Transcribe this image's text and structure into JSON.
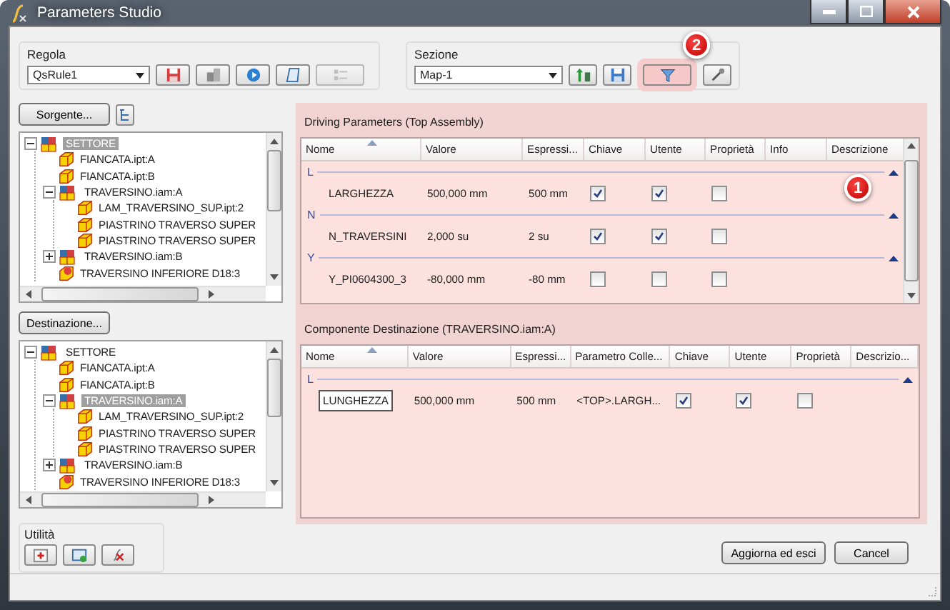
{
  "window": {
    "title": "Parameters Studio"
  },
  "regola": {
    "label": "Regola",
    "value": "QsRule1",
    "buttons": [
      {
        "kind": "save-red",
        "disabled": false
      },
      {
        "kind": "components",
        "disabled": false
      },
      {
        "kind": "run",
        "disabled": false
      },
      {
        "kind": "script",
        "disabled": false
      },
      {
        "kind": "list",
        "disabled": true
      }
    ]
  },
  "sezione": {
    "label": "Sezione",
    "value": "Map-1",
    "callout": "2",
    "buttons": [
      {
        "kind": "sort",
        "highlighted": false
      },
      {
        "kind": "save-blue",
        "highlighted": false
      },
      {
        "kind": "filter",
        "highlighted": true
      },
      {
        "kind": "tools",
        "highlighted": false
      }
    ]
  },
  "source": {
    "button": "Sorgente...",
    "tree": [
      {
        "label": "SETTORE",
        "kind": "assembly",
        "expanded": true,
        "selected": true,
        "children": [
          {
            "label": "FIANCATA.ipt:A",
            "kind": "part",
            "selected": false
          },
          {
            "label": "FIANCATA.ipt:B",
            "kind": "part",
            "selected": false
          },
          {
            "label": "TRAVERSINO.iam:A",
            "kind": "assembly",
            "expanded": true,
            "selected": false,
            "children": [
              {
                "label": "LAM_TRAVERSINO_SUP.ipt:2",
                "kind": "part",
                "selected": false
              },
              {
                "label": "PIASTRINO TRAVERSO SUPER",
                "kind": "part",
                "selected": false
              },
              {
                "label": "PIASTRINO TRAVERSO SUPER",
                "kind": "part",
                "selected": false
              }
            ]
          },
          {
            "label": "TRAVERSINO.iam:B",
            "kind": "assembly",
            "expanded": false,
            "selected": false
          },
          {
            "label": "TRAVERSINO INFERIORE D18:3",
            "kind": "linked",
            "selected": false
          }
        ]
      }
    ]
  },
  "destination": {
    "button": "Destinazione...",
    "tree": [
      {
        "label": "SETTORE",
        "kind": "assembly",
        "expanded": true,
        "selected": false,
        "children": [
          {
            "label": "FIANCATA.ipt:A",
            "kind": "part",
            "selected": false
          },
          {
            "label": "FIANCATA.ipt:B",
            "kind": "part",
            "selected": false
          },
          {
            "label": "TRAVERSINO.iam:A",
            "kind": "assembly",
            "expanded": true,
            "selected": true,
            "children": [
              {
                "label": "LAM_TRAVERSINO_SUP.ipt:2",
                "kind": "part",
                "selected": false
              },
              {
                "label": "PIASTRINO TRAVERSO SUPER",
                "kind": "part",
                "selected": false
              },
              {
                "label": "PIASTRINO TRAVERSO SUPER",
                "kind": "part",
                "selected": false
              }
            ]
          },
          {
            "label": "TRAVERSINO.iam:B",
            "kind": "assembly",
            "expanded": false,
            "selected": false
          },
          {
            "label": "TRAVERSINO INFERIORE D18:3",
            "kind": "linked",
            "selected": false
          }
        ]
      }
    ]
  },
  "utilita": {
    "label": "Utilità",
    "buttons": [
      {
        "kind": "add-part"
      },
      {
        "kind": "add-window"
      },
      {
        "kind": "delete-formula"
      }
    ]
  },
  "driving": {
    "title": "Driving Parameters (Top Assembly)",
    "callout": "1",
    "columns": [
      {
        "label": "Nome",
        "kind": "text"
      },
      {
        "label": "Valore",
        "kind": "text"
      },
      {
        "label": "Espressi...",
        "kind": "text"
      },
      {
        "label": "Chiave",
        "kind": "check"
      },
      {
        "label": "Utente",
        "kind": "check"
      },
      {
        "label": "Proprietà",
        "kind": "check"
      },
      {
        "label": "Info",
        "kind": "empty"
      },
      {
        "label": "Descrizione",
        "kind": "empty"
      }
    ],
    "groups": [
      {
        "label": "L",
        "expanded": true,
        "rows": [
          {
            "selected": false,
            "texts": [
              "LARGHEZZA",
              "500,000 mm",
              "500 mm"
            ],
            "checks": [
              true,
              true,
              false
            ]
          }
        ]
      },
      {
        "label": "N",
        "expanded": true,
        "rows": [
          {
            "selected": false,
            "texts": [
              "N_TRAVERSINI",
              "2,000 su",
              "2 su"
            ],
            "checks": [
              true,
              true,
              false
            ]
          }
        ]
      },
      {
        "label": "Y",
        "expanded": true,
        "rows": [
          {
            "selected": false,
            "texts": [
              "Y_PI0604300_3",
              "-80,000 mm",
              "-80 mm"
            ],
            "checks": [
              false,
              false,
              false
            ]
          }
        ]
      }
    ]
  },
  "component": {
    "title": "Componente Destinazione (TRAVERSINO.iam:A)",
    "columns": [
      {
        "label": "Nome",
        "kind": "text"
      },
      {
        "label": "Valore",
        "kind": "text"
      },
      {
        "label": "Espressi...",
        "kind": "text"
      },
      {
        "label": "Parametro Colle...",
        "kind": "text"
      },
      {
        "label": "Chiave",
        "kind": "check"
      },
      {
        "label": "Utente",
        "kind": "check"
      },
      {
        "label": "Proprietà",
        "kind": "check"
      },
      {
        "label": "Descrizio...",
        "kind": "empty"
      }
    ],
    "groups": [
      {
        "label": "L",
        "expanded": true,
        "rows": [
          {
            "selected": true,
            "texts": [
              "LUNGHEZZA",
              "500,000 mm",
              "500 mm",
              "<TOP>.LARGH..."
            ],
            "checks": [
              true,
              true,
              false
            ]
          }
        ]
      }
    ]
  },
  "footer": {
    "buttons": [
      "Aggiorna ed esci",
      "Cancel"
    ]
  }
}
